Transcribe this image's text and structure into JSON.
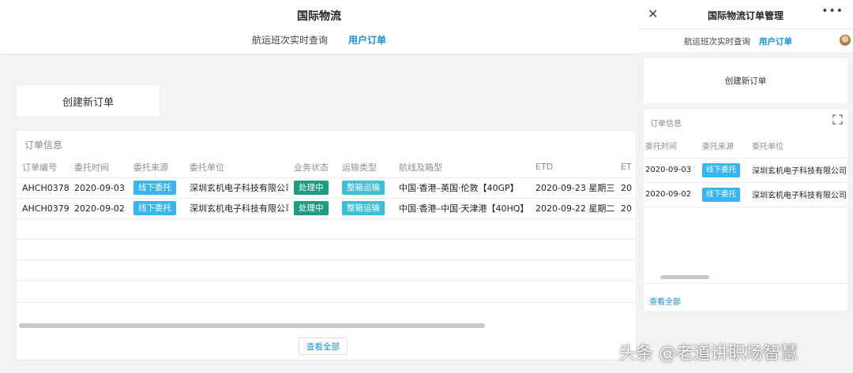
{
  "desktop": {
    "title": "国际物流",
    "tabs": [
      {
        "label": "航运班次实时查询",
        "active": false
      },
      {
        "label": "用户订单",
        "active": true
      }
    ],
    "create_order_label": "创建新订单",
    "order_section_title": "订单信息",
    "columns": [
      "订单编号",
      "委托时间",
      "委托来源",
      "委托单位",
      "业务状态",
      "运输类型",
      "航线及箱型",
      "ETD",
      "ET"
    ],
    "rows": [
      {
        "order_no": "AHCH0378",
        "date": "2020-09-03",
        "source": "线下委托",
        "company": "深圳玄机电子科技有限公司",
        "status": "处理中",
        "transport": "整箱运输",
        "route": "中国·香港–英国·伦敦【40GP】",
        "etd": "2020-09-23 星期三",
        "et": "20"
      },
      {
        "order_no": "AHCH0379",
        "date": "2020-09-02",
        "source": "线下委托",
        "company": "深圳玄机电子科技有限公司",
        "status": "处理中",
        "transport": "整箱运输",
        "route": "中国·香港–中国·天津港【40HQ】",
        "etd": "2020-09-22 星期二",
        "et": "20"
      }
    ],
    "view_all_label": "查看全部"
  },
  "mobile": {
    "title": "国际物流订单管理",
    "close_icon": "close-icon",
    "more_icon": "more-icon",
    "tabs": [
      {
        "label": "航运班次实时查询",
        "active": false
      },
      {
        "label": "用户订单",
        "active": true
      }
    ],
    "create_order_label": "创建新订单",
    "order_section_title": "订单信息",
    "columns": [
      "委托时间",
      "委托来源",
      "委托单位"
    ],
    "rows": [
      {
        "date": "2020-09-03",
        "source": "线下委托",
        "company": "深圳玄机电子科技有限公司"
      },
      {
        "date": "2020-09-02",
        "source": "线下委托",
        "company": "深圳玄机电子科技有限公司"
      }
    ],
    "view_all_label": "查看全部"
  },
  "watermark": "头条 @老道讲职场智慧",
  "colors": {
    "accent": "#1a8fd6",
    "tag_source": "#38b4f0",
    "tag_status": "#1f9b82",
    "tag_transport": "#3cc0d6"
  }
}
